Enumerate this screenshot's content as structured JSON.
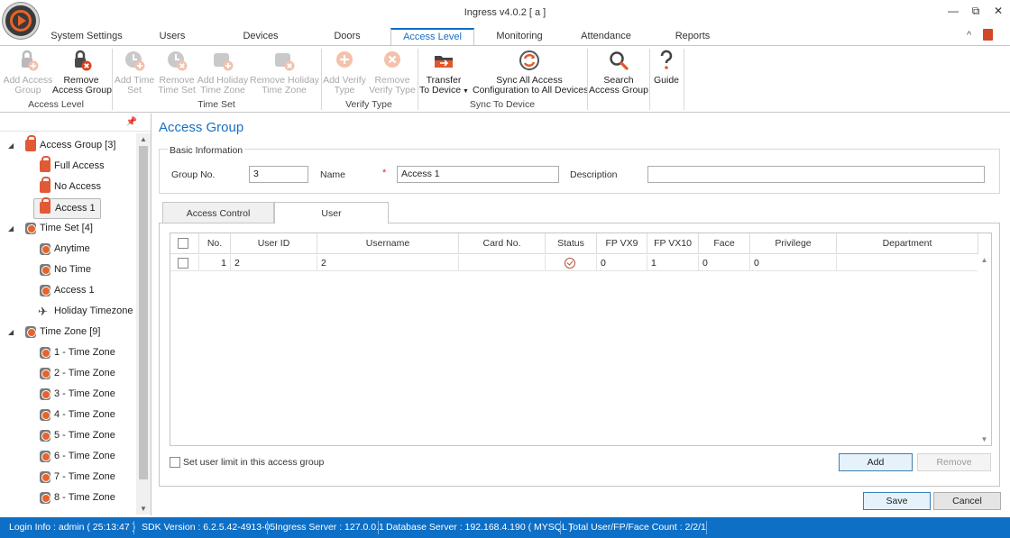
{
  "window": {
    "title": "Ingress v4.0.2 [ a ]",
    "minimize": "—",
    "restore": "⧉",
    "close": "✕"
  },
  "ribbon_tabs": [
    {
      "label": "System Settings"
    },
    {
      "label": "Users"
    },
    {
      "label": "Devices"
    },
    {
      "label": "Doors"
    },
    {
      "label": "Access Level"
    },
    {
      "label": "Monitoring"
    },
    {
      "label": "Attendance"
    },
    {
      "label": "Reports"
    }
  ],
  "ribbon_right": {
    "collapse": "^",
    "help": "⓪"
  },
  "ribbon": {
    "add_access_group": [
      "Add Access",
      "Group"
    ],
    "remove_access_group": [
      "Remove",
      "Access Group"
    ],
    "group_access_level": "Access Level",
    "add_time_set": [
      "Add Time",
      "Set"
    ],
    "remove_time_set": [
      "Remove",
      "Time Set"
    ],
    "add_holiday_tz": [
      "Add Holiday",
      "Time Zone"
    ],
    "remove_holiday_tz": [
      "Remove Holiday",
      "Time Zone"
    ],
    "group_time_set": "Time Set",
    "add_verify_type": [
      "Add Verify",
      "Type"
    ],
    "remove_verify_type": [
      "Remove",
      "Verify Type"
    ],
    "group_verify_type": "Verify Type",
    "transfer_to_device": [
      "Transfer",
      "To Device"
    ],
    "sync_all": [
      "Sync All Access",
      "Configuration to All Devices"
    ],
    "group_sync": "Sync To Device",
    "search_access_group": [
      "Search",
      "Access Group"
    ],
    "guide": [
      "Guide"
    ]
  },
  "tree": {
    "access_group": {
      "label": "Access Group [3]",
      "items": [
        "Full Access",
        "No Access",
        "Access 1"
      ]
    },
    "time_set": {
      "label": "Time Set [4]",
      "items": [
        "Anytime",
        "No Time",
        "Access 1",
        "Holiday Timezone"
      ]
    },
    "time_zone": {
      "label": "Time Zone [9]",
      "items": [
        "1 - Time Zone",
        "2 - Time Zone",
        "3 - Time Zone",
        "4 - Time Zone",
        "5 - Time Zone",
        "6 - Time Zone",
        "7 - Time Zone",
        "8 - Time Zone"
      ]
    }
  },
  "main": {
    "title": "Access Group",
    "basic_info": "Basic Information",
    "group_no_label": "Group No.",
    "group_no_value": "3",
    "name_label": "Name",
    "name_required": "*",
    "name_value": "Access 1",
    "description_label": "Description",
    "description_value": "",
    "tabs": [
      "Access Control",
      "User"
    ],
    "columns": [
      "No.",
      "User ID",
      "Username",
      "Card No.",
      "Status",
      "FP VX9",
      "FP VX10",
      "Face",
      "Privilege",
      "Department"
    ],
    "rows": [
      {
        "no": "1",
        "user_id": "2",
        "username": "2",
        "card_no": "",
        "status": "enrolled",
        "fp_vx9": "0",
        "fp_vx10": "1",
        "face": "0",
        "privilege": "0",
        "department": ""
      }
    ],
    "user_limit_label": "Set user limit in this access group",
    "add_button": "Add",
    "remove_button": "Remove",
    "save_button": "Save",
    "cancel_button": "Cancel"
  },
  "statusbar": {
    "login": "Login Info : admin ( 25:13:47 )",
    "sdk": "SDK Version : 6.2.5.42-4913-05",
    "ingress_server": "Ingress Server : 127.0.0.1",
    "db_server": "Database Server : 192.168.4.190 ( MYSQL )",
    "count": "Total User/FP/Face Count : 2/2/1"
  },
  "colors": {
    "accent": "#0d6fc6",
    "icon_orange": "#e05a36",
    "title_blue": "#1a6fc4"
  }
}
